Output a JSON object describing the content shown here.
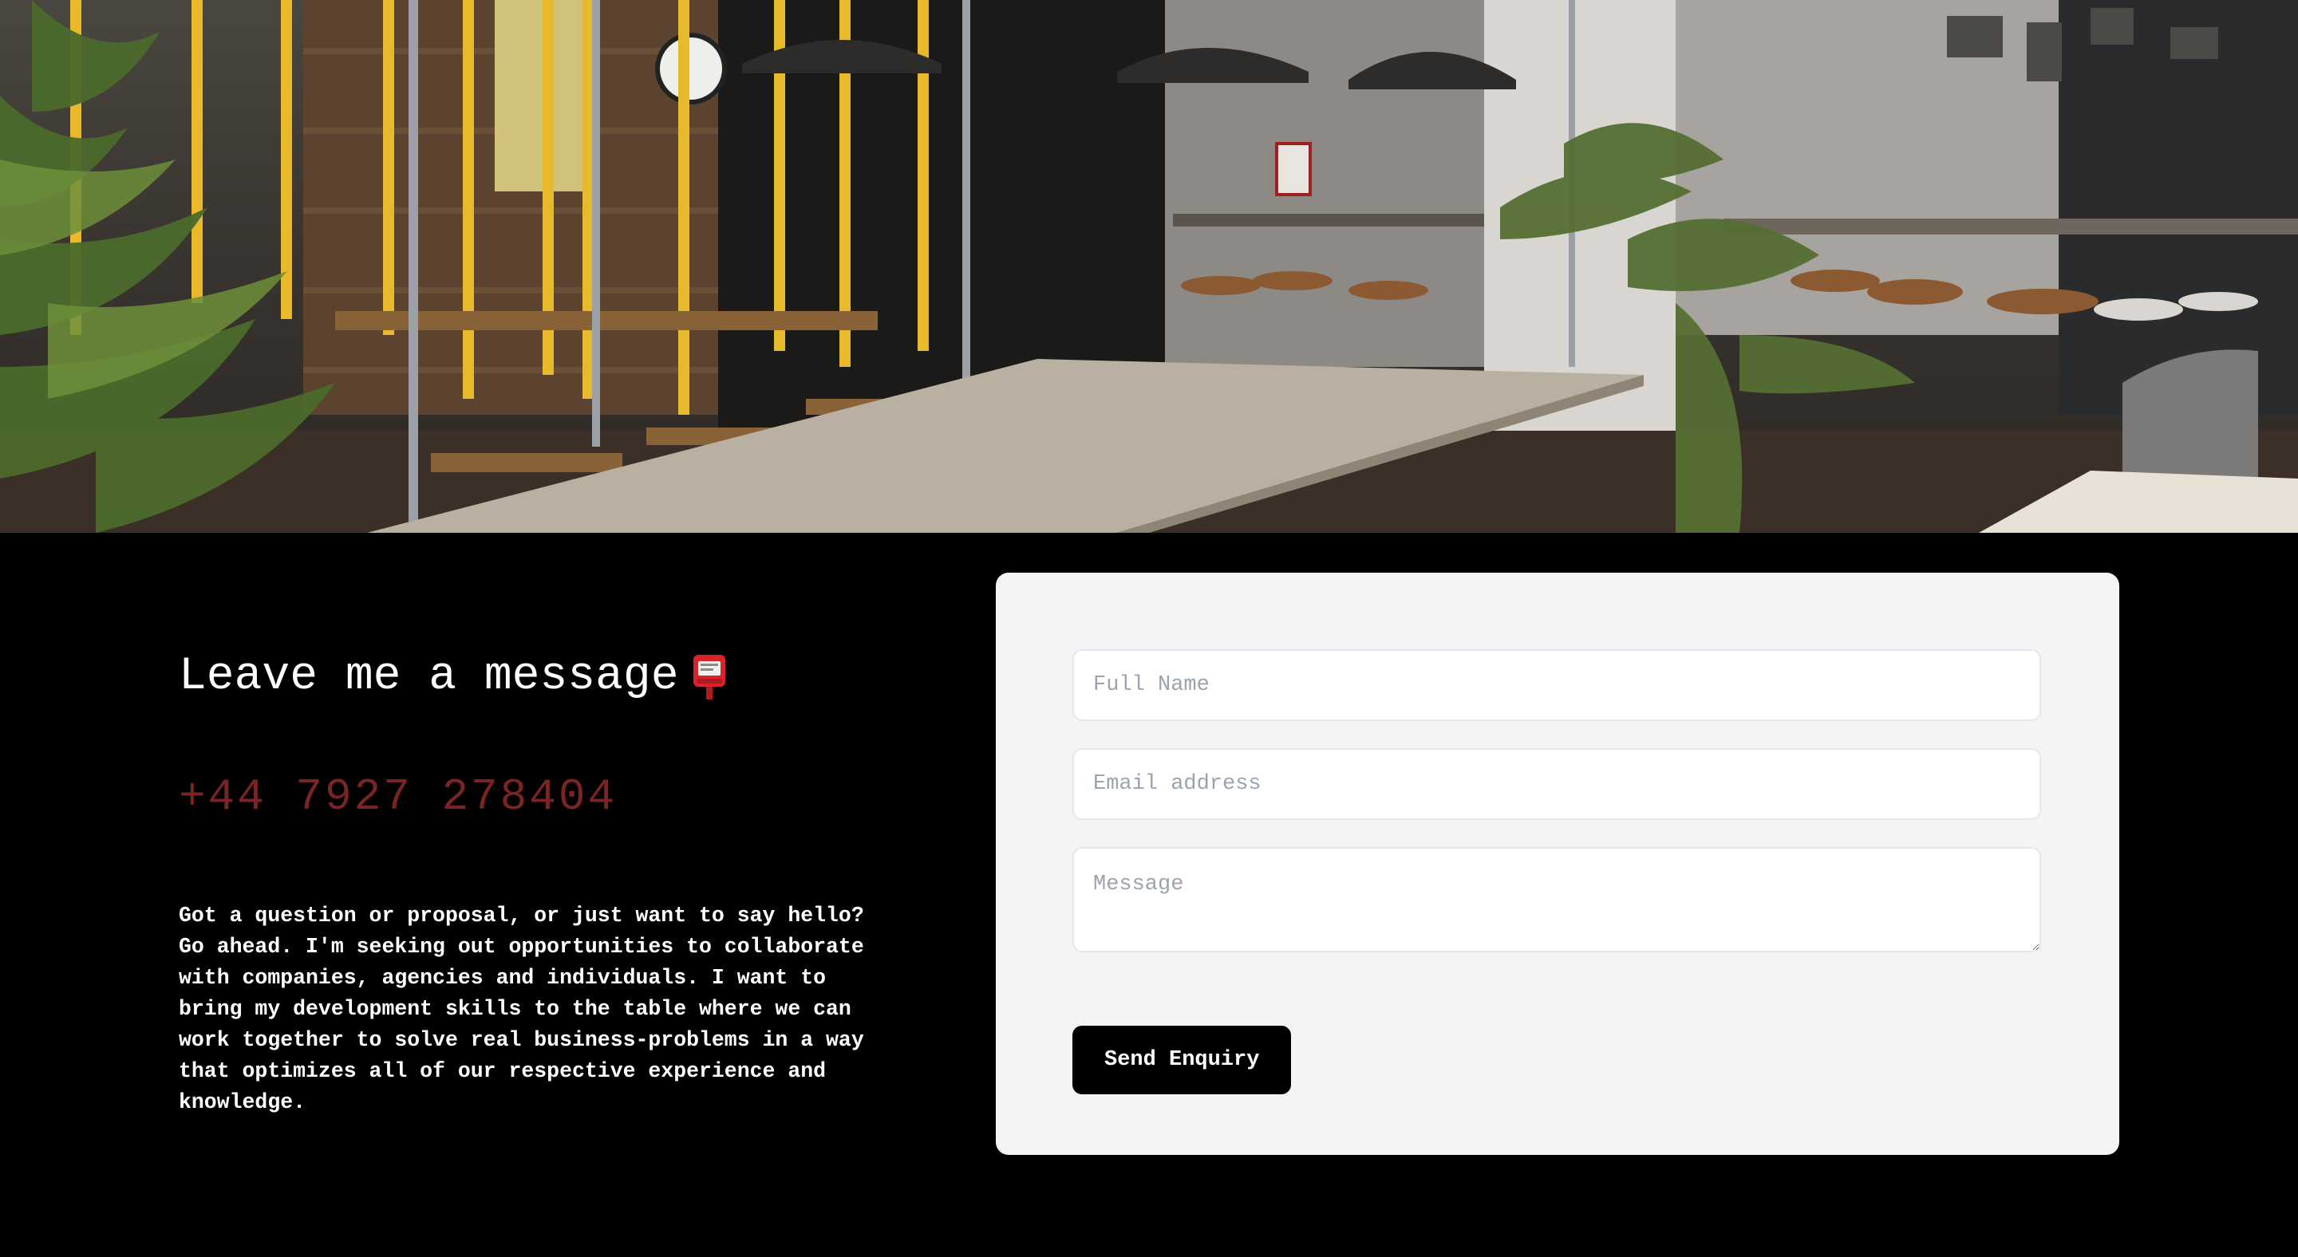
{
  "hero": {
    "image_alt": "Coworking space interior with swing seats, long table, pendant lamps and plants"
  },
  "contact": {
    "heading": "Leave me a message",
    "heading_icon": "postbox-icon",
    "phone": "+44 7927 278404",
    "blurb": "Got a question or proposal, or just want to say hello? Go ahead. I'm seeking out opportunities to collaborate with companies, agencies and individuals. I want to bring my development skills to the table where we can work together to solve real business-problems in a way that optimizes all of our respective experience and knowledge."
  },
  "form": {
    "name_placeholder": "Full Name",
    "name_value": "",
    "email_placeholder": "Email address",
    "email_value": "",
    "message_placeholder": "Message",
    "message_value": "",
    "submit_label": "Send Enquiry"
  },
  "colors": {
    "background": "#000000",
    "phone": "#7a2424",
    "card": "#f3f4f6",
    "button": "#000000",
    "swing_straps": "#e8b92a"
  }
}
